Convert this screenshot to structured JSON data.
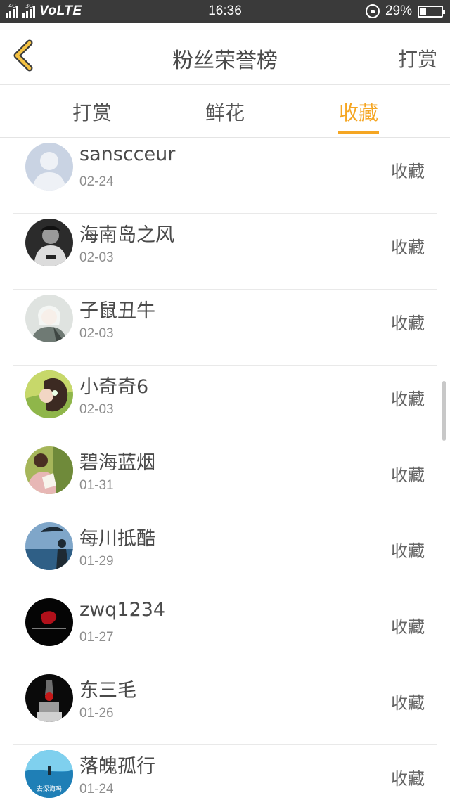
{
  "status_bar": {
    "signal_1_tag": "4G",
    "signal_2_tag": "3G",
    "network": "VoLTE",
    "time": "16:36",
    "battery_percent": "29%",
    "battery_level": 0.29
  },
  "header": {
    "title": "粉丝荣誉榜",
    "right_button": "打赏"
  },
  "tabs": [
    {
      "label": "打赏",
      "active": false
    },
    {
      "label": "鲜花",
      "active": false
    },
    {
      "label": "收藏",
      "active": true
    }
  ],
  "accent_color": "#f5a623",
  "list": [
    {
      "name": "sanscceur",
      "date": "02-24",
      "action": "收藏"
    },
    {
      "name": "海南岛之风",
      "date": "02-03",
      "action": "收藏"
    },
    {
      "name": "子鼠丑牛",
      "date": "02-03",
      "action": "收藏"
    },
    {
      "name": "小奇奇6",
      "date": "02-03",
      "action": "收藏"
    },
    {
      "name": "碧海蓝烟",
      "date": "01-31",
      "action": "收藏"
    },
    {
      "name": "每川抵酷",
      "date": "01-29",
      "action": "收藏"
    },
    {
      "name": "zwq1234",
      "date": "01-27",
      "action": "收藏"
    },
    {
      "name": "东三毛",
      "date": "01-26",
      "action": "收藏"
    },
    {
      "name": "落魄孤行",
      "date": "01-24",
      "action": "收藏"
    }
  ],
  "avatar_label_9": "去深海吗"
}
